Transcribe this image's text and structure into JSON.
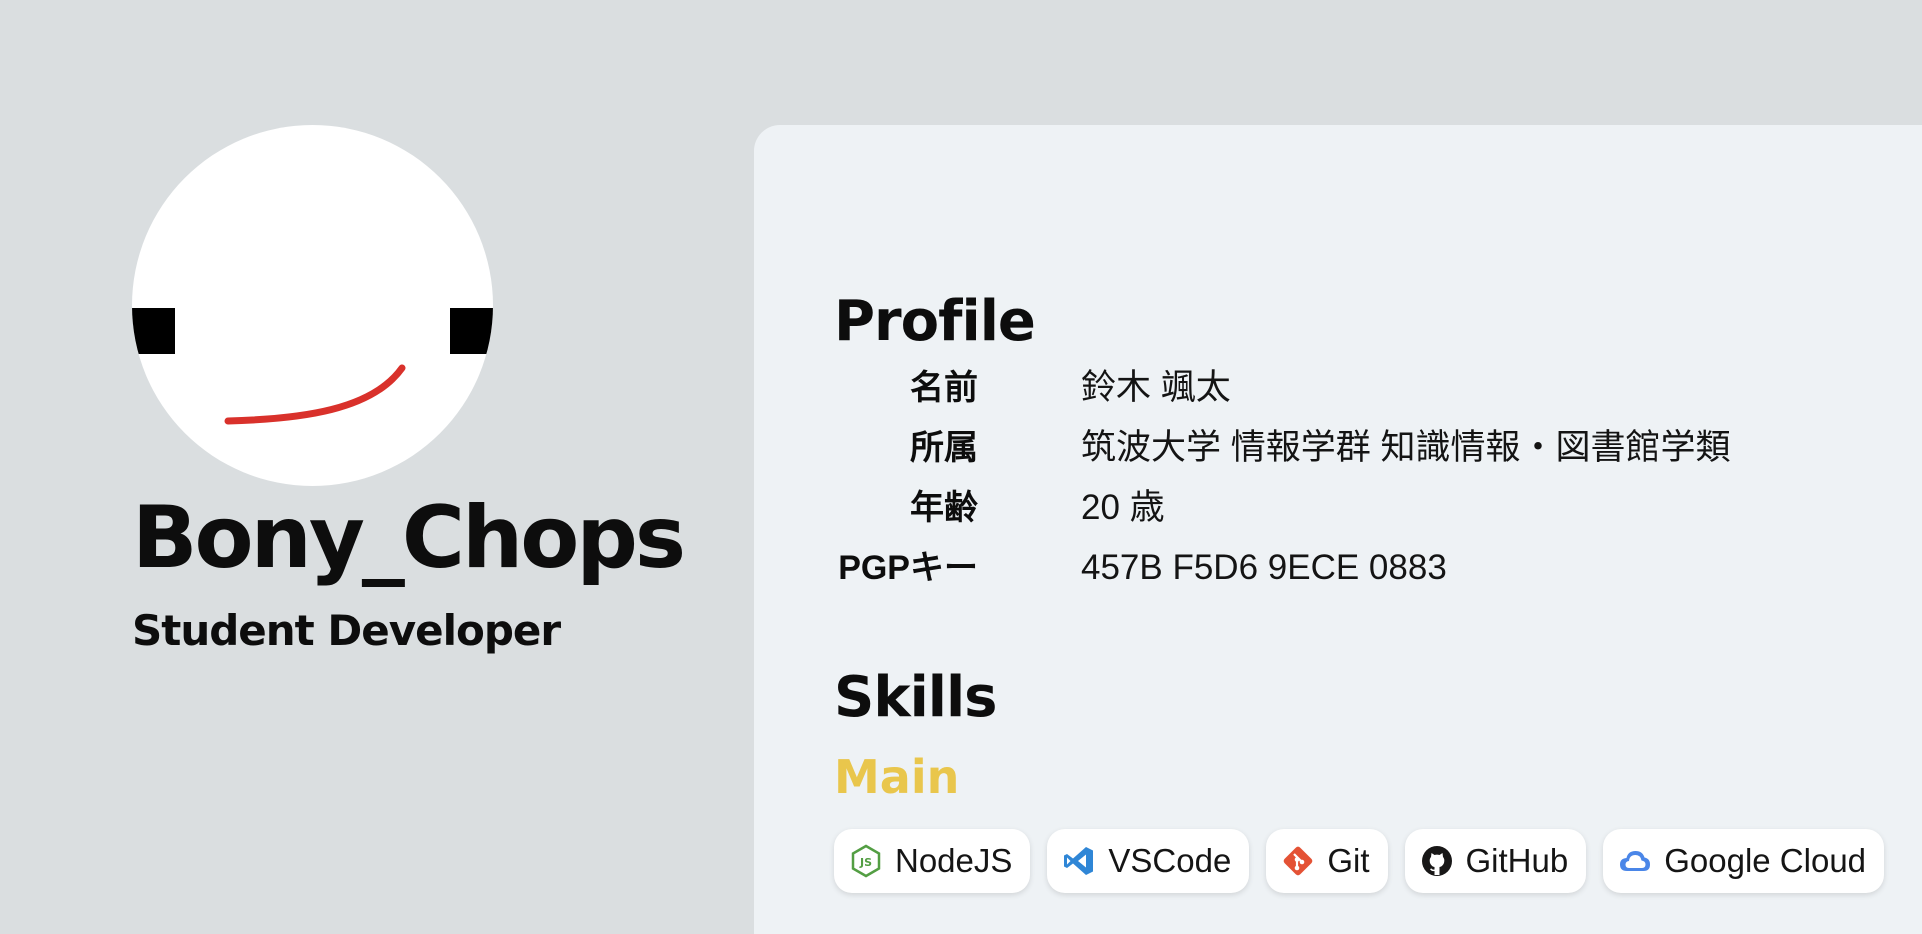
{
  "profile_card": {
    "handle": "Bony_Chops",
    "role": "Student Developer"
  },
  "profile": {
    "title": "Profile",
    "rows": [
      {
        "label": "名前",
        "value": "鈴木 颯太"
      },
      {
        "label": "所属",
        "value": "筑波大学 情報学群 知識情報・図書館学類"
      },
      {
        "label": "年齢",
        "value": "20 歳"
      },
      {
        "label": "PGPキー",
        "value": "457B F5D6 9ECE 0883"
      }
    ]
  },
  "skills": {
    "title": "Skills",
    "main_label": "Main",
    "main_color": "#e9c64c",
    "main_items": [
      {
        "label": "NodeJS",
        "icon": "nodejs-icon"
      },
      {
        "label": "VSCode",
        "icon": "vscode-icon"
      },
      {
        "label": "Git",
        "icon": "git-icon"
      },
      {
        "label": "GitHub",
        "icon": "github-icon"
      },
      {
        "label": "Google Cloud",
        "icon": "google-cloud-icon"
      }
    ]
  },
  "colors": {
    "background": "#dadee0",
    "panel": "#eef2f5",
    "avatar_smile": "#d9312b"
  }
}
